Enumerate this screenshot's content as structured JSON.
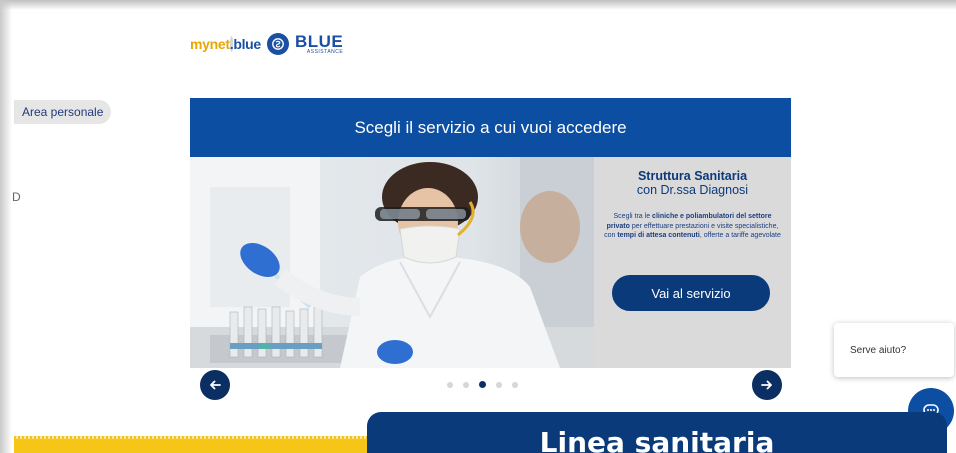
{
  "logo": {
    "part_my": "my",
    "part_net": "net",
    "part_dot": ".",
    "part_blue": "blue",
    "badge_icon": "blue-assistance-emblem",
    "brand_name": "BLUE",
    "brand_tagline": "ASSISTANCE"
  },
  "area_personale_label": "Area personale",
  "left_glyph": "D",
  "panel": {
    "header_title": "Scegli il servizio a cui vuoi accedere",
    "photo_alt": "Ricercatrice in laboratorio con pipetta",
    "info_title": "Struttura Sanitaria",
    "info_subtitle": "con Dr.ssa Diagnosi",
    "info_desc_1": "Scegli tra le ",
    "info_desc_bold_1": "cliniche e poliambulatori del settore privato",
    "info_desc_2": " per effettuare prestazioni e visite specialistiche, con ",
    "info_desc_bold_2": "tempi di attesa contenuti",
    "info_desc_3": ", offerte a tariffe agevolate",
    "service_button": "Vai al servizio"
  },
  "carousel": {
    "prev_icon": "arrow-left-icon",
    "next_icon": "arrow-right-icon",
    "active_index": 2,
    "dot_count": 5
  },
  "help": {
    "card_text": "Serve aiuto?",
    "chat_icon": "chat-bubble-icon"
  },
  "bottom_card_title": "Linea sanitaria",
  "colors": {
    "primary_blue": "#0b4ea2",
    "dark_blue": "#0b3a7a",
    "yellow": "#f5c518"
  }
}
